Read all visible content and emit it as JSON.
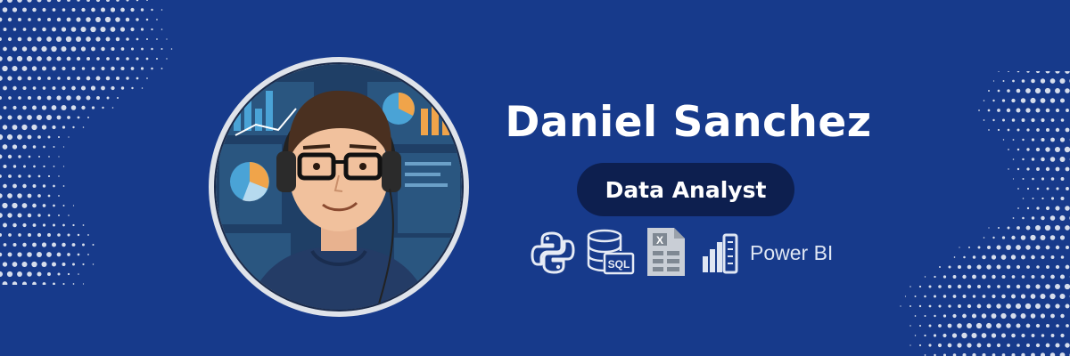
{
  "profile": {
    "name": "Daniel Sanchez",
    "role": "Data Analyst"
  },
  "tools": [
    {
      "name": "python-icon"
    },
    {
      "name": "sql-database-icon",
      "label": "SQL"
    },
    {
      "name": "excel-sheet-icon",
      "label": "X"
    },
    {
      "name": "power-bi-icon",
      "label": "Power BI"
    }
  ],
  "colors": {
    "background": "#173a8b",
    "pill": "#0d1f4f",
    "text": "#ffffff",
    "dots": "#d7deec"
  }
}
